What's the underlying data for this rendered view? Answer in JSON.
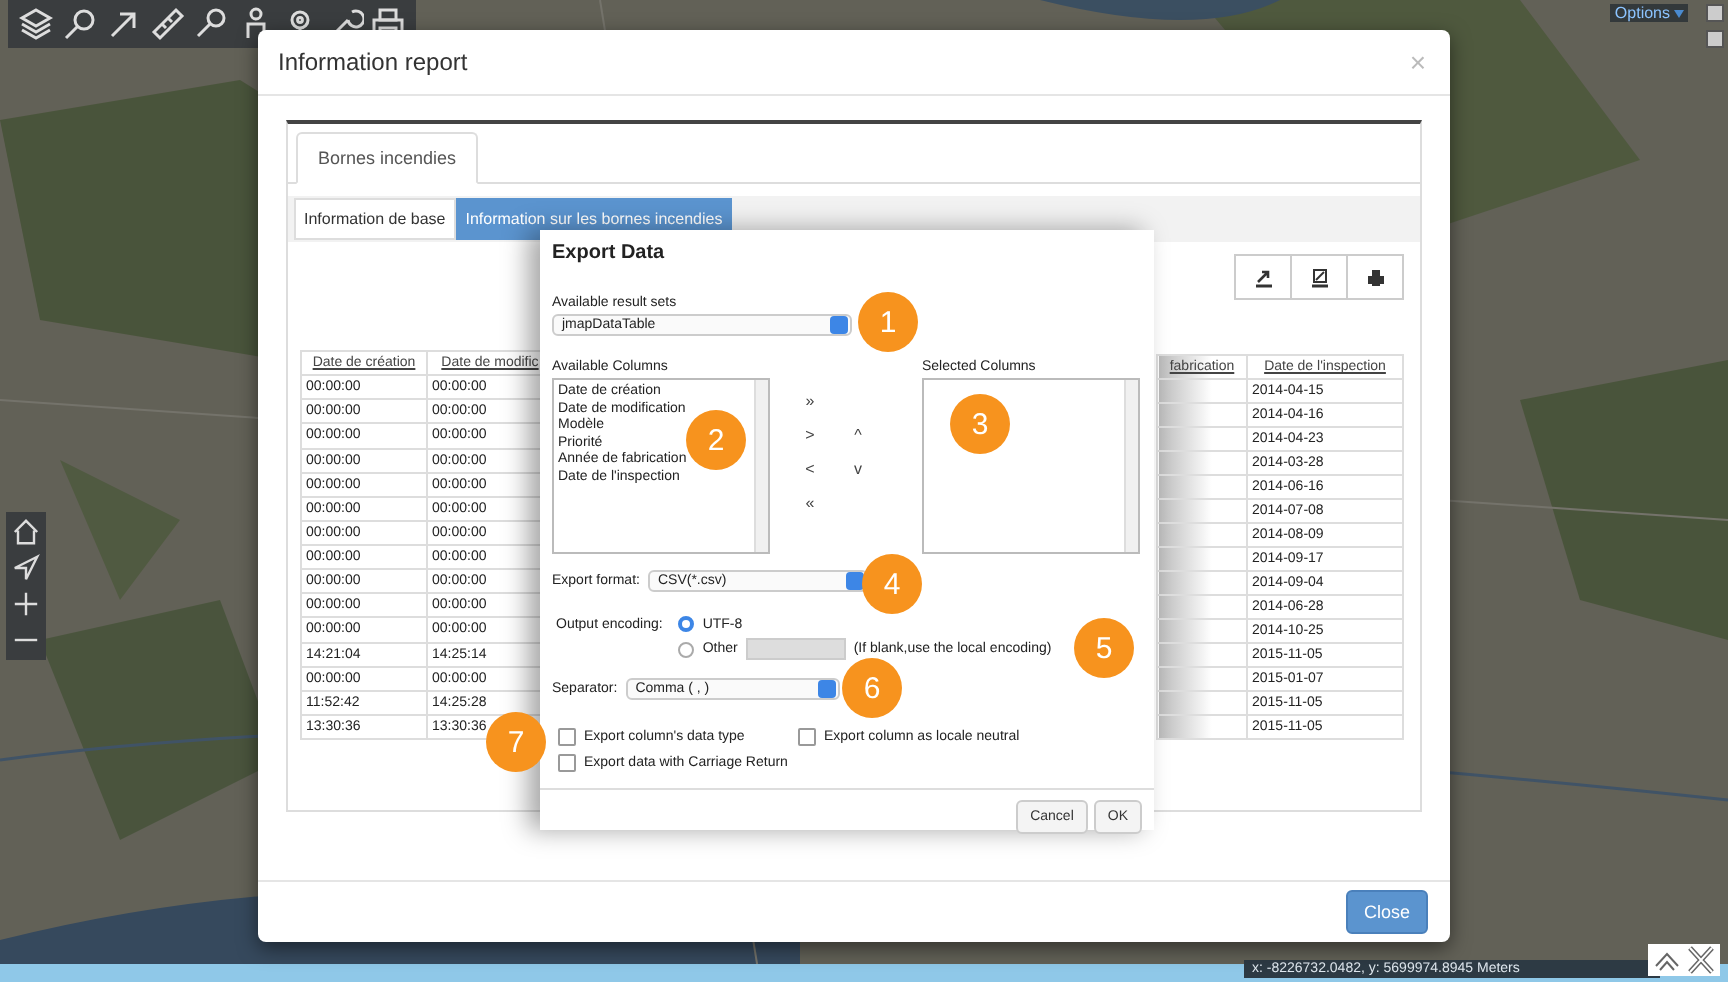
{
  "map": {
    "options_link": "Options",
    "coordinates": "x: -8226732.0482, y: 5699974.8945 Meters"
  },
  "modal": {
    "title": "Information report",
    "close": "×",
    "tabs": [
      {
        "label": "Bornes incendies",
        "selected": true
      }
    ],
    "subtabs": [
      {
        "label": "Information de base",
        "selected": false
      },
      {
        "label": "Information sur les bornes incendies",
        "selected": true
      }
    ],
    "table_left": {
      "columns": [
        "Date de création",
        "Date de modific"
      ],
      "rows": [
        [
          "00:00:00",
          "00:00:00"
        ],
        [
          "00:00:00",
          "00:00:00"
        ],
        [
          "00:00:00",
          "00:00:00"
        ],
        [
          "00:00:00",
          "00:00:00"
        ],
        [
          "00:00:00",
          "00:00:00"
        ],
        [
          "00:00:00",
          "00:00:00"
        ],
        [
          "00:00:00",
          "00:00:00"
        ],
        [
          "00:00:00",
          "00:00:00"
        ],
        [
          "00:00:00",
          "00:00:00"
        ],
        [
          "00:00:00",
          "00:00:00"
        ],
        [
          "00:00:00",
          "00:00:00"
        ],
        [
          "14:21:04",
          "14:25:14"
        ],
        [
          "00:00:00",
          "00:00:00"
        ],
        [
          "11:52:42",
          "14:25:28"
        ],
        [
          "13:30:36",
          "13:30:36"
        ]
      ]
    },
    "table_right": {
      "columns": [
        "fabrication",
        "Date de l'inspection"
      ],
      "inspection_dates": [
        "2014-04-15",
        "2014-04-16",
        "2014-04-23",
        "2014-03-28",
        "2014-06-16",
        "2014-07-08",
        "2014-08-09",
        "2014-09-17",
        "2014-09-04",
        "2014-06-28",
        "2014-10-25",
        "2015-11-05",
        "2015-01-07",
        "2015-11-05",
        "2015-11-05"
      ]
    },
    "close_button": "Close"
  },
  "export_dialog": {
    "title": "Export Data",
    "result_sets_label": "Available result sets",
    "result_set": "jmapDataTable",
    "available_label": "Available Columns",
    "available_columns": [
      "Date de création",
      "Date de modification",
      "Modèle",
      "Priorité",
      "Année de fabrication",
      "Date de l'inspection"
    ],
    "selected_label": "Selected Columns",
    "move_buttons": [
      "»",
      ">",
      "<",
      "«"
    ],
    "order_buttons": [
      "^",
      "v"
    ],
    "format_label": "Export format:",
    "format": "CSV(*.csv)",
    "encoding_label": "Output encoding:",
    "encodings": [
      {
        "label": "UTF-8",
        "selected": true
      },
      {
        "label": "Other",
        "selected": false
      }
    ],
    "encoding_hint": "(If blank,use the local encoding)",
    "separator_label": "Separator:",
    "separator": "Comma ( , )",
    "options": [
      {
        "label": "Export column's data type",
        "checked": false
      },
      {
        "label": "Export column as locale neutral",
        "checked": false
      },
      {
        "label": "Export data with Carriage Return",
        "checked": false
      }
    ],
    "buttons": [
      "Cancel",
      "OK"
    ]
  },
  "annotations": [
    "1",
    "2",
    "3",
    "4",
    "5",
    "6",
    "7"
  ]
}
